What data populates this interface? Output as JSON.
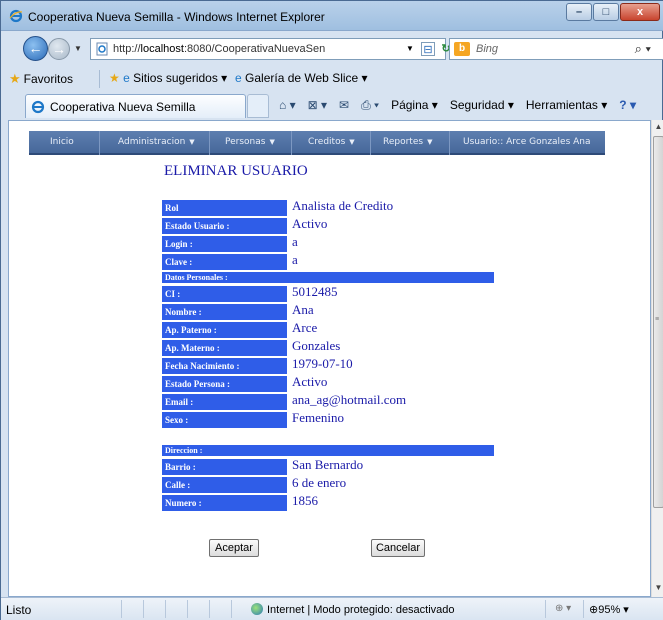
{
  "window": {
    "title": "Cooperativa Nueva Semilla - Windows Internet Explorer",
    "controls": {
      "minimize": "–",
      "maximize": "□",
      "close": "x"
    }
  },
  "address": {
    "url_prefix": "http://",
    "url_host": "localhost",
    "url_rest": ":8080/CooperativaNuevaSen"
  },
  "search": {
    "placeholder": "Bing",
    "engine": "b"
  },
  "favorites": {
    "favorites_label": "Favoritos",
    "suggested_label": "Sitios sugeridos ▾",
    "gallery_label": "Galería de Web Slice ▾"
  },
  "tab": {
    "label": "Cooperativa Nueva Semilla"
  },
  "commandbar": {
    "page": "Página ▾",
    "security": "Seguridad ▾",
    "tools": "Herramientas ▾"
  },
  "menu": {
    "items": [
      {
        "label": "Inicio",
        "caret": ""
      },
      {
        "label": "Administracion",
        "caret": "▼"
      },
      {
        "label": "Personas",
        "caret": "▼"
      },
      {
        "label": "Creditos",
        "caret": "▼"
      },
      {
        "label": "Reportes",
        "caret": "▼"
      },
      {
        "label": "Usuario:: Arce Gonzales Ana",
        "caret": ""
      }
    ]
  },
  "page": {
    "heading": "ELIMINAR USUARIO"
  },
  "form": {
    "rol": {
      "label": "Rol",
      "value": "Analista de Credito"
    },
    "estado_usuario": {
      "label": "Estado Usuario :",
      "value": "Activo"
    },
    "login": {
      "label": "Login :",
      "value": "a"
    },
    "clave": {
      "label": "Clave :",
      "value": "a"
    },
    "datos_personales": "Datos Personales :",
    "ci": {
      "label": "CI :",
      "value": "5012485"
    },
    "nombre": {
      "label": "Nombre :",
      "value": "Ana"
    },
    "ap_paterno": {
      "label": "Ap. Paterno :",
      "value": "Arce"
    },
    "ap_materno": {
      "label": "Ap. Materno :",
      "value": "Gonzales"
    },
    "fecha_nacimiento": {
      "label": "Fecha Nacimiento :",
      "value": "1979-07-10"
    },
    "estado_persona": {
      "label": "Estado Persona :",
      "value": "Activo"
    },
    "email": {
      "label": "Email :",
      "value": "ana_ag@hotmail.com"
    },
    "sexo": {
      "label": "Sexo :",
      "value": "Femenino"
    },
    "direccion": "Direccion :",
    "barrio": {
      "label": "Barrio :",
      "value": "San Bernardo"
    },
    "calle": {
      "label": "Calle :",
      "value": "6 de enero"
    },
    "numero": {
      "label": "Numero :",
      "value": "1856"
    }
  },
  "buttons": {
    "accept": "Aceptar",
    "cancel": "Cancelar"
  },
  "status": {
    "text": "Listo",
    "zone": "Internet | Modo protegido: desactivado",
    "zoom": "95%"
  },
  "colors": {
    "label_bg": "#2f5de8",
    "value_text": "#1a1aa8",
    "menu_bg": "#4e6fa3"
  }
}
